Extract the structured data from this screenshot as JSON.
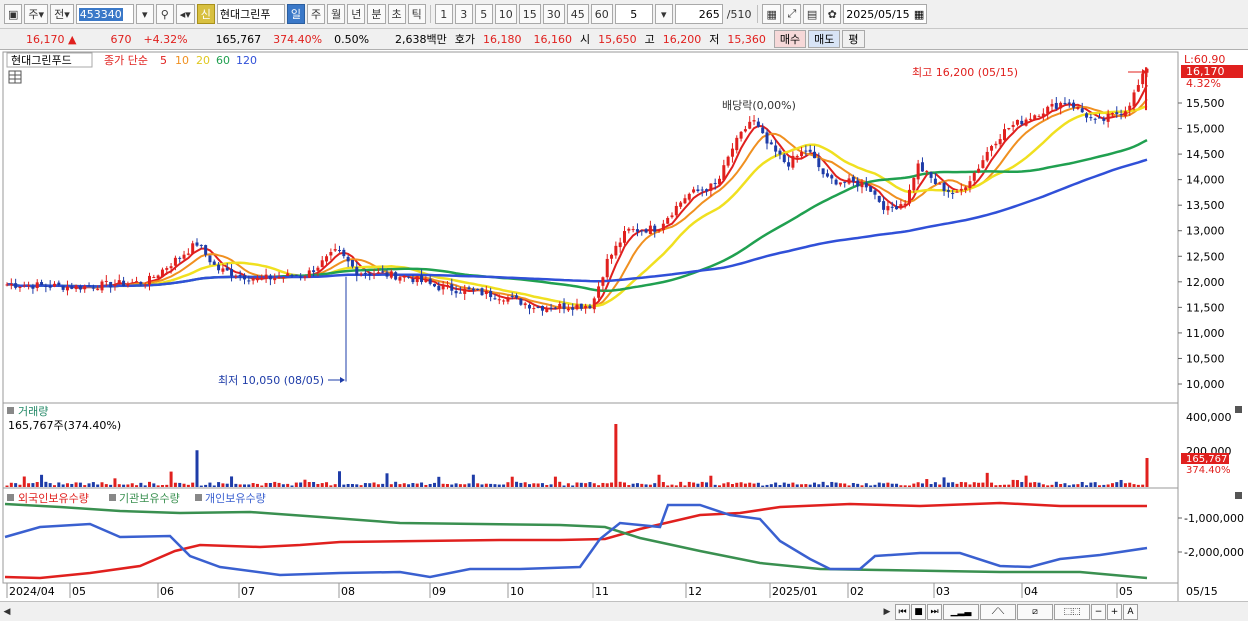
{
  "toolbar": {
    "market": "주",
    "prev": "전",
    "code": "453340",
    "name": "현대그린푸",
    "sin_label": "신",
    "periods": [
      "일",
      "주",
      "월",
      "년",
      "분",
      "초",
      "틱"
    ],
    "active_period": "일",
    "intervals": [
      "1",
      "3",
      "5",
      "10",
      "15",
      "30",
      "45",
      "60"
    ],
    "interval_value": "5",
    "count": "265",
    "total": "/510",
    "date": "2025/05/15"
  },
  "info": {
    "price": "16,170",
    "change": "670",
    "change_pct": "+4.32%",
    "volume": "165,767",
    "volume_ratio": "374.40%",
    "turnover": "0.50%",
    "amount": "2,638백만",
    "ask_label": "호가",
    "ask": "16,180",
    "bid": "16,160",
    "open_label": "시",
    "open": "15,650",
    "high_label": "고",
    "high": "16,200",
    "low_label": "저",
    "low": "15,360",
    "buy": "매수",
    "sell": "매도",
    "avg": "평"
  },
  "price_panel": {
    "name": "현대그린푸드",
    "legend_title": "종가 단순",
    "ma_labels": [
      "5",
      "10",
      "20",
      "60",
      "120"
    ],
    "ma_colors": [
      "#e0201e",
      "#f09020",
      "#f0e020",
      "#20a050",
      "#3050d8"
    ],
    "top_right_label": "L:60.90",
    "current_price": "16,170",
    "current_pct": "4.32%",
    "high_annotation": "최고 16,200 (05/15)",
    "low_annotation": "최저 10,050 (08/05)",
    "mid_annotation": "배당락(0,00%)",
    "y_ticks": [
      "15,500",
      "15,000",
      "14,500",
      "14,000",
      "13,500",
      "13,000",
      "12,500",
      "12,000",
      "11,500",
      "11,000",
      "10,500",
      "10,000"
    ]
  },
  "volume_panel": {
    "title": "거래량",
    "value": "165,767주(374.40%)",
    "y_ticks": [
      "400,000",
      "200,000"
    ],
    "current": "165,767",
    "current_pct": "374.40%"
  },
  "holding_panel": {
    "legend": [
      "외국인보유수량",
      "기관보유수량",
      "개인보유수량"
    ],
    "y_ticks": [
      "-1,000,000",
      "-2,000,000"
    ]
  },
  "x_axis": {
    "labels": [
      "2024/04",
      "05",
      "06",
      "07",
      "08",
      "09",
      "10",
      "11",
      "12",
      "2025/01",
      "02",
      "03",
      "04",
      "05"
    ],
    "right_label": "05/15"
  },
  "colors": {
    "up": "#e0201e",
    "down": "#1e3ca8",
    "foreign": "#e0201e",
    "institution": "#3a9050",
    "individual": "#3a60d0"
  }
}
